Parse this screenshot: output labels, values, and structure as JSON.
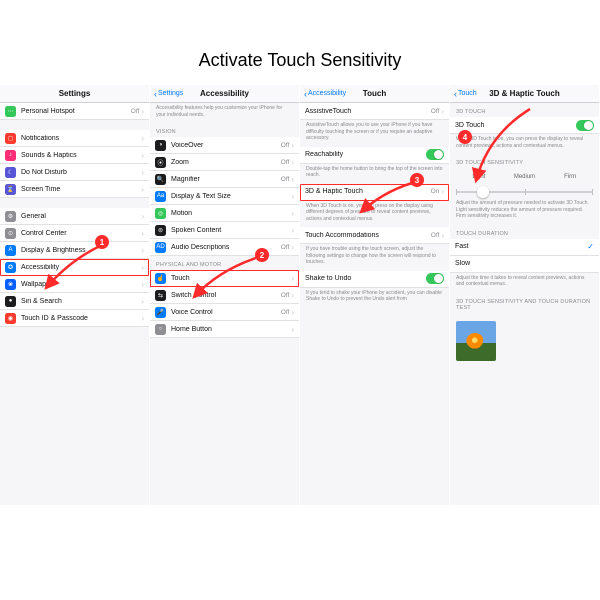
{
  "title": "Activate Touch Sensitivity",
  "panel1": {
    "header": "Settings",
    "rows": [
      {
        "icon": "hotspot-icon",
        "bg": "bg-green",
        "glyph": "⋯",
        "label": "Personal Hotspot",
        "val": "Off"
      },
      {
        "gap": true
      },
      {
        "icon": "notifications-icon",
        "bg": "bg-red",
        "glyph": "◻",
        "label": "Notifications"
      },
      {
        "icon": "sounds-icon",
        "bg": "bg-pink",
        "glyph": "♪",
        "label": "Sounds & Haptics"
      },
      {
        "icon": "dnd-icon",
        "bg": "bg-purple",
        "glyph": "☾",
        "label": "Do Not Disturb"
      },
      {
        "icon": "screentime-icon",
        "bg": "bg-purple",
        "glyph": "⌛",
        "label": "Screen Time"
      },
      {
        "gap": true
      },
      {
        "icon": "general-icon",
        "bg": "bg-gray",
        "glyph": "⚙",
        "label": "General"
      },
      {
        "icon": "control-center-icon",
        "bg": "bg-gray",
        "glyph": "⊙",
        "label": "Control Center"
      },
      {
        "icon": "display-icon",
        "bg": "bg-blue",
        "glyph": "A",
        "label": "Display & Brightness"
      },
      {
        "icon": "accessibility-icon",
        "bg": "bg-blue",
        "glyph": "✪",
        "label": "Accessibility",
        "hl": true
      },
      {
        "icon": "wallpaper-icon",
        "bg": "bg-dblue",
        "glyph": "❀",
        "label": "Wallpaper"
      },
      {
        "icon": "siri-icon",
        "bg": "bg-black",
        "glyph": "●",
        "label": "Siri & Search"
      },
      {
        "icon": "touchid-icon",
        "bg": "bg-red",
        "glyph": "◉",
        "label": "Touch ID & Passcode"
      }
    ],
    "badge": "1"
  },
  "panel2": {
    "back": "Settings",
    "header": "Accessibility",
    "intro": "Accessibility features help you customize your iPhone for your individual needs.",
    "sect1": "VISION",
    "rows1": [
      {
        "icon": "voiceover-icon",
        "bg": "bg-black",
        "glyph": "◑",
        "label": "VoiceOver",
        "val": "Off"
      },
      {
        "icon": "zoom-icon",
        "bg": "bg-black",
        "glyph": "⦿",
        "label": "Zoom",
        "val": "Off"
      },
      {
        "icon": "magnifier-icon",
        "bg": "bg-black",
        "glyph": "🔍",
        "label": "Magnifier",
        "val": "Off"
      },
      {
        "icon": "display-text-icon",
        "bg": "bg-blue",
        "glyph": "Aa",
        "label": "Display & Text Size"
      },
      {
        "icon": "motion-icon",
        "bg": "bg-green",
        "glyph": "◎",
        "label": "Motion"
      },
      {
        "icon": "spoken-icon",
        "bg": "bg-black",
        "glyph": "⊜",
        "label": "Spoken Content"
      },
      {
        "icon": "audio-desc-icon",
        "bg": "bg-blue",
        "glyph": "AD",
        "label": "Audio Descriptions",
        "val": "Off"
      }
    ],
    "sect2": "PHYSICAL AND MOTOR",
    "rows2": [
      {
        "icon": "touch-icon",
        "bg": "bg-blue",
        "glyph": "☝",
        "label": "Touch",
        "hl": true
      },
      {
        "icon": "switch-icon",
        "bg": "bg-black",
        "glyph": "⇆",
        "label": "Switch Control",
        "val": "Off"
      },
      {
        "icon": "voice-control-icon",
        "bg": "bg-blue",
        "glyph": "🎤",
        "label": "Voice Control",
        "val": "Off"
      },
      {
        "icon": "home-button-icon",
        "bg": "bg-gray",
        "glyph": "○",
        "label": "Home Button"
      }
    ],
    "badge": "2"
  },
  "panel3": {
    "back": "Accessibility",
    "header": "Touch",
    "rows": [
      {
        "label": "AssistiveTouch",
        "val": "Off",
        "chev": true
      },
      {
        "desc": "AssistiveTouch allows you to use your iPhone if you have difficulty touching the screen or if you require an adaptive accessory."
      },
      {
        "label": "Reachability",
        "toggle": true
      },
      {
        "desc": "Double-tap the home button to bring the top of the screen into reach."
      },
      {
        "label": "3D & Haptic Touch",
        "val": "On",
        "chev": true,
        "hl": true
      },
      {
        "desc": "When 3D Touch is on, you can press on the display using different degrees of pressure to reveal content previews, actions and contextual menus."
      },
      {
        "label": "Touch Accommodations",
        "val": "Off",
        "chev": true
      },
      {
        "desc": "If you have trouble using the touch screen, adjust the following settings to change how the screen will respond to touches."
      },
      {
        "label": "Shake to Undo",
        "toggle": true
      },
      {
        "desc": "If you tend to shake your iPhone by accident, you can disable Shake to Undo to prevent the Undo alert from"
      }
    ],
    "badge": "3"
  },
  "panel4": {
    "back": "Touch",
    "header": "3D & Haptic Touch",
    "sect1": "3D TOUCH",
    "row1": {
      "label": "3D Touch"
    },
    "desc1": "When 3D Touch is on, you can press the display to reveal content previews, actions and contextual menus.",
    "sect2": "3D TOUCH SENSITIVITY",
    "seg": [
      "Light",
      "Medium",
      "Firm"
    ],
    "desc2": "Adjust the amount of pressure needed to activate 3D Touch. Light sensitivity reduces the amount of pressure required. Firm sensitivity increases it.",
    "sect3": "TOUCH DURATION",
    "rows3": [
      {
        "label": "Fast",
        "check": true
      },
      {
        "label": "Slow"
      }
    ],
    "desc3": "Adjust the time it takes to reveal content previews, actions and contextual menus.",
    "sect4": "3D TOUCH SENSITIVITY AND TOUCH DURATION TEST",
    "badge": "4"
  }
}
